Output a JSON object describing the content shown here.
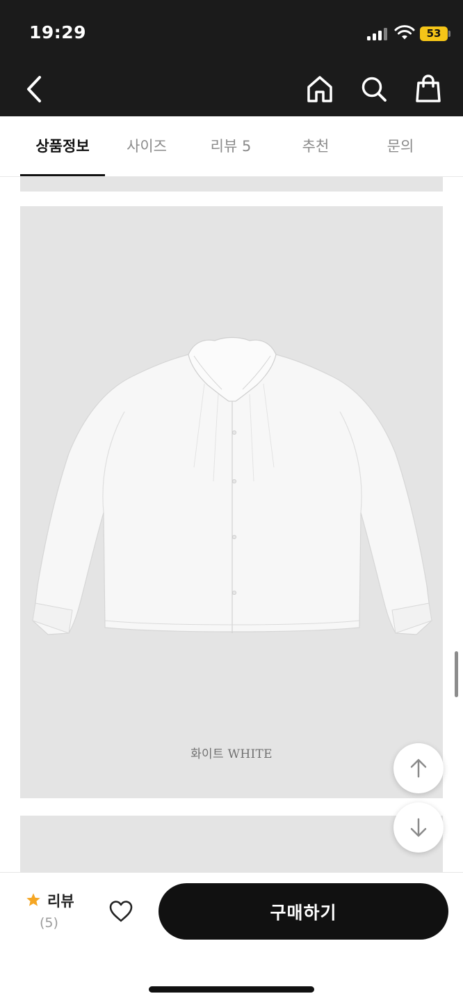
{
  "status_bar": {
    "time": "19:29",
    "battery": "53",
    "battery_color": "#f5c518"
  },
  "header": {
    "back_icon": "chevron-left-icon",
    "home_icon": "home-icon",
    "search_icon": "search-icon",
    "cart_icon": "shopping-bag-icon"
  },
  "tabs": [
    {
      "label": "상품정보",
      "active": true
    },
    {
      "label": "사이즈",
      "active": false
    },
    {
      "label": "리뷰 5",
      "active": false
    },
    {
      "label": "추천",
      "active": false
    },
    {
      "label": "문의",
      "active": false
    }
  ],
  "product": {
    "image_caption": "화이트 WHITE"
  },
  "scroll_buttons": {
    "up_icon": "arrow-up-icon",
    "down_icon": "arrow-down-icon"
  },
  "bottom_bar": {
    "review_label": "리뷰",
    "review_count": "(5)",
    "star_color": "#f5a623",
    "wishlist_icon": "heart-outline-icon",
    "buy_label": "구매하기"
  }
}
